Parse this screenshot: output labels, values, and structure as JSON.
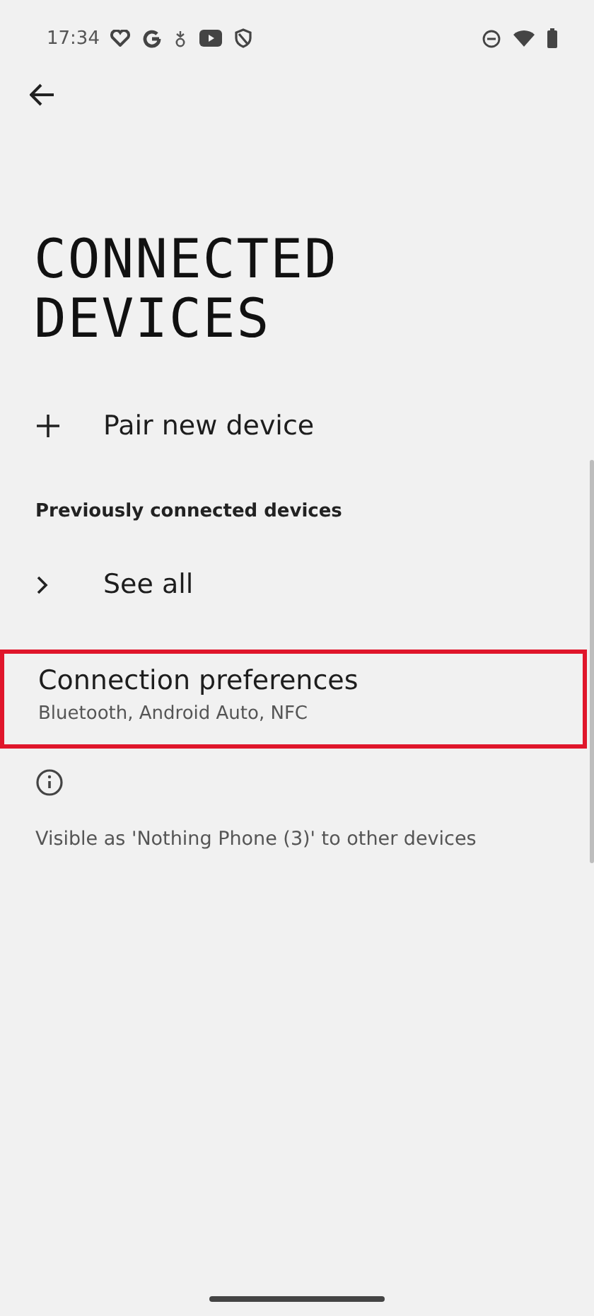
{
  "status_bar": {
    "time": "17:34"
  },
  "title_lines": [
    "CONNECTED",
    "DEVICES"
  ],
  "items": [
    {
      "kind": "action",
      "label": "Pair new device"
    },
    {
      "kind": "header",
      "label": "Previously connected devices"
    },
    {
      "kind": "link",
      "label": "See all"
    },
    {
      "kind": "pref",
      "label": "Connection preferences",
      "summary": "Bluetooth, Android Auto, NFC",
      "highlighted": true
    },
    {
      "kind": "footer",
      "label": "Visible as 'Nothing Phone (3)' to other devices"
    }
  ]
}
